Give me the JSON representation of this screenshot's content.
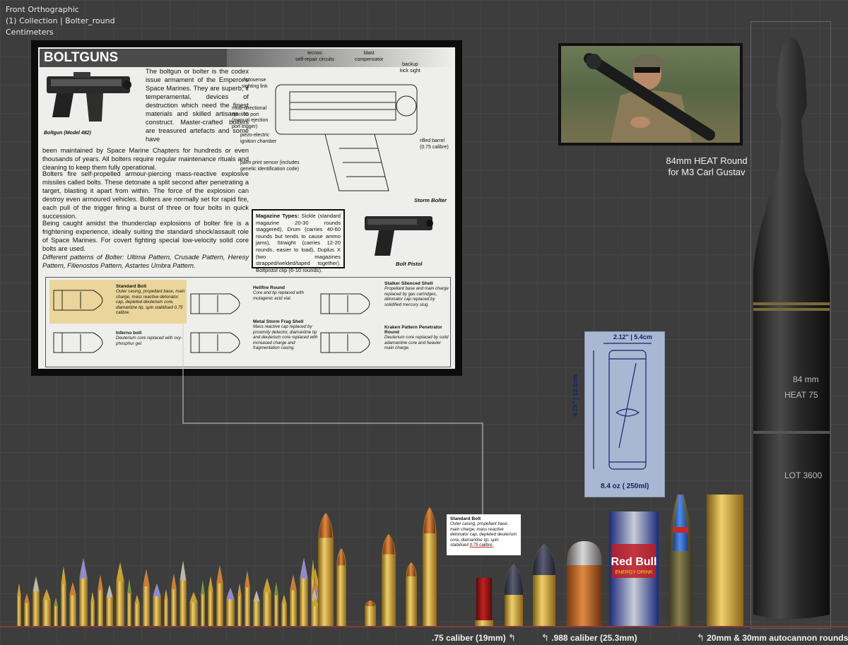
{
  "viewport": {
    "view": "Front Orthographic",
    "collection": "(1) Collection | Bolter_round",
    "units": "Centimeters"
  },
  "codex": {
    "title": "BOLTGUNS",
    "boltgun_caption": "Boltgun (Model 482)",
    "para1_top": "The boltgun or bolter is the codex issue armament of the Emperor's Space Marines. They are superb, if temperamental, devices of destruction which need the finest materials and skilled artisans to construct. Master-crafted bolters are treasured artefacts and some have",
    "para1_rest": "been maintained by Space Marine Chapters for hundreds or even thousands of years. All bolters require regular maintenance rituals and cleaning to keep them fully operational.",
    "para2": "Bolters fire self-propelled armour-piercing mass-reactive explosive missiles called bolts. These detonate a split second after penetrating a target, blasting it apart from within. The force of the explosion can destroy even armoured vehicles. Bolters are normally set for rapid fire, each pull of the trigger firing a burst of three or four bolts in quick succession.",
    "para3": "Being caught amidst the thunderclap explosions of bolter fire is a frightening experience, ideally suiting the standard shock/assault role of Space Marines. For covert fighting special low-velocity solid core bolts are used.",
    "para4": "Different patterns of Bolter: Ultima Pattern, Crusade Pattern, Heresy Pattern, Filienostos Pattern, Astartes Umbra Pattern.",
    "diagram_labels": {
      "tecnos": "tecnos\nself-repair circuits",
      "blast": "blast\ncompensator",
      "backup": "backup\nkick sight",
      "autosense": "autosense\nsighting link",
      "multi": "multi-directional\nejection port\n(manual ejection\nport trigger)",
      "piezo": "piezo-electric\nignition chamber",
      "rifled": "rifled barrel\n(0.75 calibre)",
      "palm": "palm print sensor (includes\ngenetic identification code)",
      "storm_bolter": "Storm Bolter"
    },
    "magazine_title": "Magazine Types:",
    "magazine_text": " Sickle (standard magazine 20-30 rounds staggered), Drum (carries 40-60 rounds but tends to cause ammo jams), Straight (carries 12-20 rounds, easier to load), Duplus X (two magazines strapped/welded/taped together). Boltpistol clip (6-10 rounds).",
    "bolt_pistol": "Bolt Pistol",
    "bolts": [
      {
        "title": "Standard Bolt",
        "desc": "Outer casing, propellant base, main charge, mass reactive detonator cap, depleted deuterium core, diamantine tip, spin stabilised 0.75 calibre."
      },
      {
        "title": "Inferno bolt",
        "desc": "Deuterium core replaced with oxy-phosphur gel."
      },
      {
        "title": "Hellfire Round",
        "desc": "Core and tip replaced with mutagenic acid vial."
      },
      {
        "title": "Metal Storm Frag Shell",
        "desc": "Mass reactive cap replaced by proximity detector, diamantine tip and deuterium core replaced with increased charge and fragmentation casing."
      },
      {
        "title": "Stalker Silenced Shell",
        "desc": "Propellant base and main charge replaced by gas cartridges, detonator cap replaced by solidified mercury slug."
      },
      {
        "title": "Kraken Pattern Penetrator Round",
        "desc": "Deuterium core replaced by solid adamantine core and heavier main charge."
      }
    ]
  },
  "photo_label_line1": "84mm HEAT Round",
  "photo_label_line2": "for M3 Carl Gustav",
  "can": {
    "width_label": "2.12\" | 5.4cm",
    "height_label": "4.75\" | 12.1cm",
    "volume": "8.4 oz ( 250ml)",
    "brand": "Red Bull",
    "sub": "ENERGY DRINK"
  },
  "heat": {
    "line1": "84 mm",
    "line2": "HEAT 75",
    "lot": "LOT 3600"
  },
  "callout": {
    "title": "Standard Bolt",
    "text": "Outer casing, propellant base, main charge, mass reactive detonator cap, depleted deuterium core, diamantine tip, spin stabilised ",
    "highlight": "0.75 calibre."
  },
  "bottom_labels": {
    "bolt": ".75 caliber (19mm)",
    "heavy": ".988 caliber (25.3mm)",
    "autocannon": "20mm & 30mm autocannon rounds"
  },
  "colors": {
    "brass": "#c9a233",
    "highlight_yellow": "#ead59a",
    "ground_line": "#8a3a3a",
    "blueprint_ink": "#12246e",
    "autocannon_tip": "#2f5fc0"
  }
}
